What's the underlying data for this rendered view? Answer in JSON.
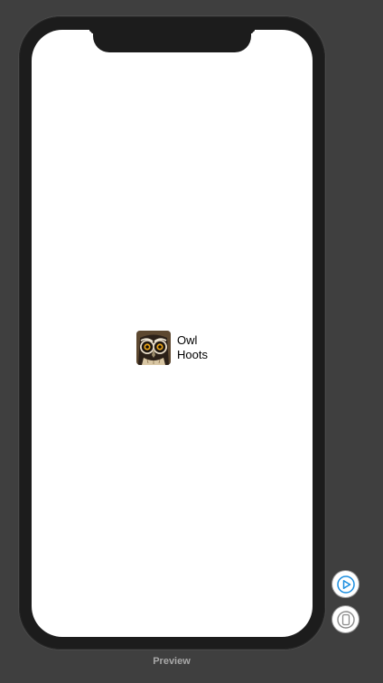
{
  "preview": {
    "label": "Preview"
  },
  "cell": {
    "image": "owl-photo",
    "line1": "Owl",
    "line2": "Hoots"
  },
  "controls": {
    "live_preview_icon": "play-circle-icon",
    "device_preview_icon": "device-icon",
    "accent_color": "#1a8ee0"
  }
}
